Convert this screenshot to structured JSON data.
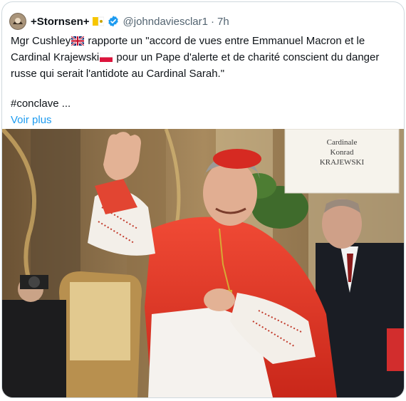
{
  "author": {
    "display_name": "+Stornsen+",
    "handle": "@johndaviesclar1",
    "separator": "·",
    "time": "7h",
    "verified_icon": "verified-badge-icon",
    "name_emoji": "vatican-flag-icon"
  },
  "tweet": {
    "line1_a": "Mgr Cushley",
    "line1_b": " rapporte un \"accord de vues entre Emmanuel Macron et le Cardinal Krajewski",
    "line1_c": " pour un Pape d'alerte et de charité conscient du danger russe qui serait l'antidote au Cardinal Sarah.\"",
    "hashtag_line": "#conclave ...",
    "show_more": "Voir plus"
  },
  "media": {
    "sign_line1": "Cardinale",
    "sign_line2": "Konrad",
    "sign_line3": "KRAJEWSKI"
  },
  "colors": {
    "link": "#1d9bf0",
    "text": "#0f1419",
    "secondary": "#536471",
    "verified": "#1d9bf0"
  }
}
